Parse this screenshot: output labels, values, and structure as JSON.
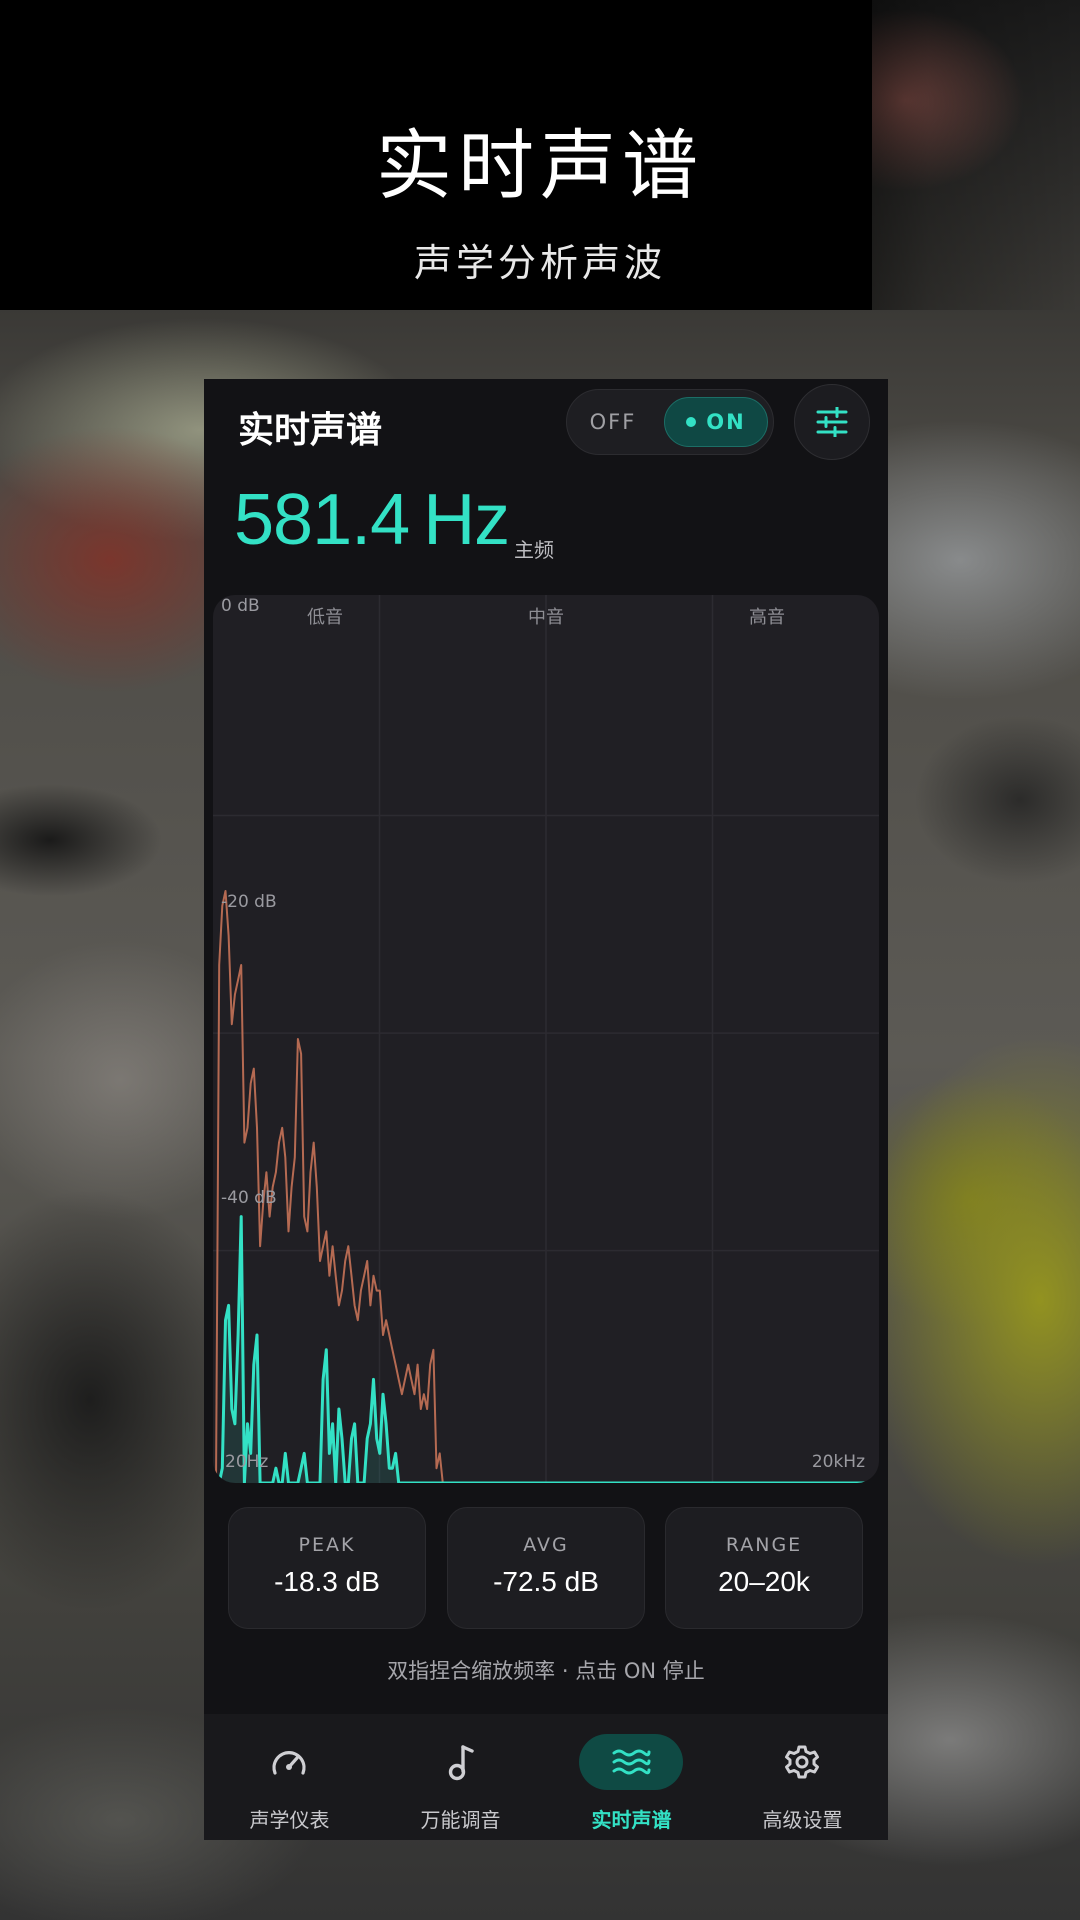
{
  "promo": {
    "title": "实时声谱",
    "subtitle": "声学分析声波"
  },
  "header": {
    "title": "实时声谱",
    "toggle": {
      "off_label": "OFF",
      "on_label": "ON",
      "state": "on"
    },
    "settings_icon": "sliders-icon"
  },
  "frequency": {
    "value": "581.4",
    "unit": "Hz",
    "label": "主频"
  },
  "spectrum": {
    "bands": [
      "低音",
      "中音",
      "高音"
    ],
    "db_labels": [
      "0 dB",
      "-20 dB",
      "-40 dB"
    ],
    "x_labels": {
      "left": "20Hz",
      "right": "20kHz"
    }
  },
  "chart_data": {
    "type": "line",
    "y_unit": "dB",
    "ylim": [
      -60,
      0
    ],
    "y_ticks": [
      "0 dB",
      "-20 dB",
      "-40 dB"
    ],
    "x_range": [
      "20Hz",
      "20kHz"
    ],
    "grid": true,
    "series": [
      {
        "role": "peak-hold",
        "color": "#b56a52",
        "values": [
          -60,
          -25,
          -21,
          -20,
          -23,
          -29,
          -27,
          -26,
          -25,
          -37,
          -36,
          -33,
          -32,
          -36,
          -44,
          -41,
          -39,
          -42,
          -40,
          -39,
          -37,
          -36,
          -38,
          -43,
          -40,
          -38,
          -30,
          -31,
          -42,
          -43,
          -39,
          -37,
          -40,
          -45,
          -44,
          -43,
          -46,
          -44,
          -46,
          -48,
          -47,
          -45,
          -44,
          -46,
          -48,
          -49,
          -47,
          -46,
          -45,
          -48,
          -46,
          -47,
          -47,
          -50,
          -49,
          -50,
          -51,
          -52,
          -53,
          -54,
          -53,
          -52,
          -53,
          -54,
          -52,
          -55,
          -54,
          -55,
          -52,
          -51,
          -59,
          -58,
          -60,
          -60
        ]
      },
      {
        "role": "live",
        "color": "#33e1c5",
        "values": [
          -60,
          -60,
          -59,
          -49,
          -48,
          -55,
          -56,
          -50,
          -42,
          -60,
          -56,
          -58,
          -52,
          -50,
          -60,
          -60,
          -60,
          -60,
          -60,
          -59,
          -60,
          -60,
          -58,
          -60,
          -60,
          -60,
          -60,
          -59,
          -58,
          -60,
          -60,
          -60,
          -60,
          -60,
          -53,
          -51,
          -58,
          -56,
          -60,
          -55,
          -57,
          -60,
          -60,
          -57,
          -56,
          -60,
          -60,
          -60,
          -57,
          -56,
          -53,
          -57,
          -58,
          -54,
          -56,
          -59,
          -59,
          -58,
          -60,
          -60,
          -60,
          -60,
          -60,
          -60,
          -60,
          -60,
          -60,
          -60,
          -60,
          -60,
          -60,
          -60,
          -60,
          -60
        ]
      }
    ]
  },
  "stats": [
    {
      "label": "PEAK",
      "value": "-18.3 dB"
    },
    {
      "label": "AVG",
      "value": "-72.5 dB"
    },
    {
      "label": "RANGE",
      "value": "20–20k"
    }
  ],
  "hint": "双指捏合缩放频率 · 点击 ON 停止",
  "nav": {
    "items": [
      {
        "label": "声学仪表",
        "icon": "gauge-icon",
        "active": false
      },
      {
        "label": "万能调音",
        "icon": "music-note-icon",
        "active": false
      },
      {
        "label": "实时声谱",
        "icon": "waves-icon",
        "active": true
      },
      {
        "label": "高级设置",
        "icon": "gear-icon",
        "active": false
      }
    ]
  },
  "colors": {
    "accent": "#33e1c5",
    "peak_trace": "#b56a52",
    "panel": "#121215",
    "chart_bg": "#201f24"
  }
}
